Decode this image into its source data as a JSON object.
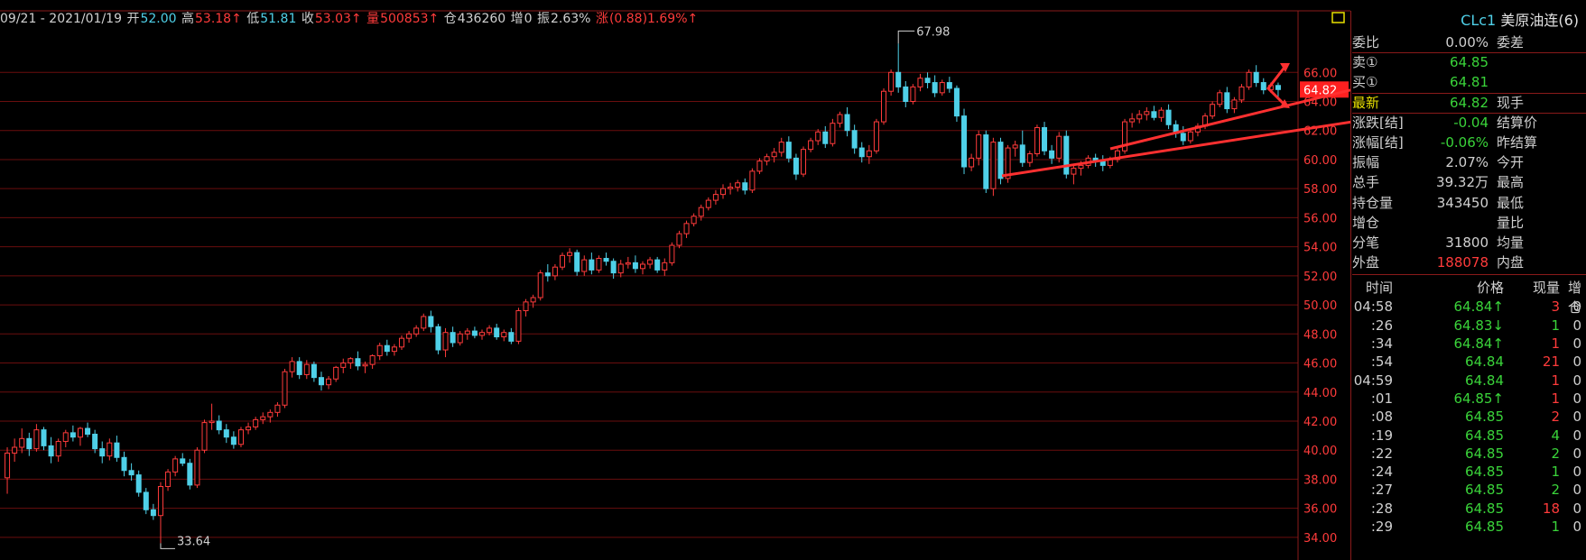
{
  "topbar": {
    "date_range": "09/21 - 2021/01/19",
    "open_label": "开",
    "open_val": "52.00",
    "high_label": "高",
    "high_val": "53.18↑",
    "low_label": "低",
    "low_val": "51.81",
    "close_label": "收",
    "close_val": "53.03↑",
    "vol_label": "量",
    "vol_val": "500853↑",
    "oi_label": "仓",
    "oi_val": "436260",
    "add_label": "增",
    "add_val": "0",
    "amp_label": "振",
    "amp_val": "2.63%",
    "chg_label": "涨",
    "chg_val": "(0.88)1.69%↑"
  },
  "chart_data": {
    "type": "candlestick",
    "y_ticks": [
      "66.00",
      "64.00",
      "62.00",
      "60.00",
      "58.00",
      "56.00",
      "54.00",
      "52.00",
      "50.00",
      "48.00",
      "46.00",
      "44.00",
      "42.00",
      "40.00",
      "38.00",
      "36.00",
      "34.00"
    ],
    "ylim": [
      33,
      68.5
    ],
    "current_price": "64.82",
    "high_annotation": "67.98",
    "low_annotation": "33.64",
    "candles": [
      [
        38.1,
        40.2,
        37.0,
        39.8
      ],
      [
        39.8,
        40.8,
        39.2,
        40.2
      ],
      [
        40.2,
        41.5,
        39.8,
        40.8
      ],
      [
        40.8,
        41.2,
        39.6,
        40.1
      ],
      [
        40.1,
        41.8,
        39.9,
        41.4
      ],
      [
        41.4,
        41.6,
        40.0,
        40.3
      ],
      [
        40.3,
        40.9,
        39.1,
        39.6
      ],
      [
        39.6,
        40.8,
        39.2,
        40.6
      ],
      [
        40.6,
        41.4,
        40.2,
        41.2
      ],
      [
        41.2,
        41.7,
        40.6,
        40.9
      ],
      [
        40.9,
        41.6,
        40.3,
        41.5
      ],
      [
        41.5,
        41.9,
        40.9,
        41.1
      ],
      [
        41.1,
        41.4,
        39.8,
        40.1
      ],
      [
        40.1,
        40.6,
        39.1,
        39.6
      ],
      [
        39.6,
        40.8,
        39.3,
        40.5
      ],
      [
        40.5,
        41.0,
        39.2,
        39.5
      ],
      [
        39.5,
        39.9,
        38.2,
        38.6
      ],
      [
        38.6,
        39.1,
        37.9,
        38.3
      ],
      [
        38.3,
        38.6,
        36.8,
        37.1
      ],
      [
        37.1,
        37.4,
        35.6,
        35.9
      ],
      [
        35.9,
        36.3,
        35.2,
        35.5
      ],
      [
        35.5,
        37.8,
        33.6,
        37.5
      ],
      [
        37.5,
        38.7,
        37.2,
        38.5
      ],
      [
        38.5,
        39.6,
        38.2,
        39.4
      ],
      [
        39.4,
        39.8,
        38.9,
        39.1
      ],
      [
        39.1,
        39.4,
        37.3,
        37.6
      ],
      [
        37.6,
        40.2,
        37.4,
        40.0
      ],
      [
        40.0,
        42.1,
        39.8,
        41.9
      ],
      [
        41.9,
        43.2,
        41.4,
        42.0
      ],
      [
        42.0,
        42.4,
        41.1,
        41.4
      ],
      [
        41.4,
        41.8,
        40.5,
        40.9
      ],
      [
        40.9,
        41.3,
        40.1,
        40.4
      ],
      [
        40.4,
        41.6,
        40.2,
        41.4
      ],
      [
        41.4,
        41.9,
        41.1,
        41.6
      ],
      [
        41.6,
        42.3,
        41.4,
        42.1
      ],
      [
        42.1,
        42.6,
        41.8,
        42.3
      ],
      [
        42.3,
        42.8,
        41.9,
        42.6
      ],
      [
        42.6,
        43.3,
        42.3,
        43.1
      ],
      [
        43.1,
        45.6,
        42.9,
        45.4
      ],
      [
        45.4,
        46.4,
        45.0,
        46.1
      ],
      [
        46.1,
        46.4,
        44.9,
        45.2
      ],
      [
        45.2,
        46.2,
        44.9,
        45.9
      ],
      [
        45.9,
        46.1,
        44.7,
        45.0
      ],
      [
        45.0,
        45.4,
        44.1,
        44.5
      ],
      [
        44.5,
        45.1,
        44.2,
        44.9
      ],
      [
        44.9,
        45.8,
        44.7,
        45.7
      ],
      [
        45.7,
        46.3,
        45.3,
        46.0
      ],
      [
        46.0,
        46.4,
        45.6,
        46.3
      ],
      [
        46.3,
        46.8,
        45.5,
        45.8
      ],
      [
        45.8,
        46.1,
        45.3,
        45.9
      ],
      [
        45.9,
        46.6,
        45.6,
        46.5
      ],
      [
        46.5,
        47.4,
        46.2,
        47.2
      ],
      [
        47.2,
        47.6,
        46.5,
        46.8
      ],
      [
        46.8,
        47.3,
        46.5,
        47.1
      ],
      [
        47.1,
        47.9,
        46.9,
        47.7
      ],
      [
        47.7,
        48.2,
        47.4,
        48.0
      ],
      [
        48.0,
        48.6,
        47.8,
        48.4
      ],
      [
        48.4,
        49.4,
        48.2,
        49.2
      ],
      [
        49.2,
        49.6,
        48.1,
        48.5
      ],
      [
        48.5,
        48.7,
        46.6,
        46.9
      ],
      [
        46.9,
        48.4,
        46.4,
        48.1
      ],
      [
        48.1,
        48.5,
        47.1,
        47.4
      ],
      [
        47.4,
        48.2,
        47.2,
        48.0
      ],
      [
        48.0,
        48.4,
        47.6,
        48.2
      ],
      [
        48.2,
        48.5,
        47.7,
        47.9
      ],
      [
        47.9,
        48.3,
        47.6,
        48.1
      ],
      [
        48.1,
        48.6,
        47.9,
        48.4
      ],
      [
        48.4,
        48.7,
        47.6,
        47.8
      ],
      [
        47.8,
        48.3,
        47.5,
        48.1
      ],
      [
        48.1,
        48.4,
        47.3,
        47.5
      ],
      [
        47.5,
        49.8,
        47.3,
        49.6
      ],
      [
        49.6,
        50.4,
        49.2,
        50.2
      ],
      [
        50.2,
        50.7,
        49.8,
        50.5
      ],
      [
        50.5,
        52.4,
        50.3,
        52.2
      ],
      [
        52.2,
        52.8,
        51.6,
        52.0
      ],
      [
        52.0,
        52.8,
        51.7,
        52.6
      ],
      [
        52.6,
        53.6,
        52.4,
        53.4
      ],
      [
        53.4,
        53.9,
        52.9,
        53.6
      ],
      [
        53.6,
        53.8,
        52.0,
        52.3
      ],
      [
        52.3,
        53.4,
        52.0,
        53.1
      ],
      [
        53.1,
        53.6,
        52.1,
        52.4
      ],
      [
        52.4,
        53.4,
        52.2,
        53.2
      ],
      [
        53.2,
        53.6,
        52.7,
        53.0
      ],
      [
        53.0,
        53.2,
        51.8,
        52.2
      ],
      [
        52.2,
        53.1,
        51.9,
        52.8
      ],
      [
        52.8,
        53.3,
        52.5,
        52.9
      ],
      [
        52.9,
        53.4,
        52.2,
        52.5
      ],
      [
        52.5,
        53.0,
        52.1,
        52.8
      ],
      [
        52.8,
        53.3,
        52.5,
        53.1
      ],
      [
        53.1,
        53.3,
        52.2,
        52.4
      ],
      [
        52.4,
        53.2,
        52.0,
        52.9
      ],
      [
        52.9,
        54.3,
        52.7,
        54.1
      ],
      [
        54.1,
        55.1,
        53.9,
        54.9
      ],
      [
        54.9,
        55.8,
        54.6,
        55.6
      ],
      [
        55.6,
        56.3,
        55.4,
        56.1
      ],
      [
        56.1,
        56.9,
        55.8,
        56.7
      ],
      [
        56.7,
        57.4,
        56.5,
        57.2
      ],
      [
        57.2,
        57.9,
        56.9,
        57.6
      ],
      [
        57.6,
        58.3,
        57.3,
        58.0
      ],
      [
        58.0,
        58.4,
        57.6,
        58.1
      ],
      [
        58.1,
        58.6,
        57.8,
        58.4
      ],
      [
        58.4,
        58.7,
        57.6,
        57.9
      ],
      [
        57.9,
        59.4,
        57.7,
        59.2
      ],
      [
        59.2,
        60.1,
        59.0,
        59.9
      ],
      [
        59.9,
        60.4,
        59.6,
        60.2
      ],
      [
        60.2,
        60.8,
        59.8,
        60.5
      ],
      [
        60.5,
        61.5,
        60.2,
        61.2
      ],
      [
        61.2,
        61.6,
        59.8,
        60.1
      ],
      [
        60.1,
        60.4,
        58.6,
        59.0
      ],
      [
        59.0,
        60.9,
        58.8,
        60.7
      ],
      [
        60.7,
        61.5,
        60.5,
        61.3
      ],
      [
        61.3,
        62.1,
        61.0,
        61.9
      ],
      [
        61.9,
        62.3,
        60.8,
        61.1
      ],
      [
        61.1,
        62.8,
        60.9,
        62.5
      ],
      [
        62.5,
        63.3,
        62.2,
        63.1
      ],
      [
        63.1,
        63.6,
        61.6,
        62.0
      ],
      [
        62.0,
        62.4,
        60.4,
        60.8
      ],
      [
        60.8,
        61.2,
        59.8,
        60.2
      ],
      [
        60.2,
        61.0,
        59.7,
        60.6
      ],
      [
        60.6,
        62.8,
        60.4,
        62.6
      ],
      [
        62.6,
        64.9,
        62.4,
        64.7
      ],
      [
        64.7,
        66.2,
        64.4,
        66.0
      ],
      [
        66.0,
        67.98,
        64.6,
        65.0
      ],
      [
        65.0,
        65.4,
        63.6,
        64.0
      ],
      [
        64.0,
        65.2,
        63.8,
        65.0
      ],
      [
        65.0,
        65.9,
        64.7,
        65.6
      ],
      [
        65.6,
        66.0,
        64.9,
        65.3
      ],
      [
        65.3,
        65.8,
        64.3,
        64.6
      ],
      [
        64.6,
        65.5,
        64.4,
        65.3
      ],
      [
        65.3,
        65.7,
        64.6,
        64.9
      ],
      [
        64.9,
        65.1,
        62.6,
        63.0
      ],
      [
        63.0,
        63.5,
        59.0,
        59.5
      ],
      [
        59.5,
        60.4,
        59.2,
        60.1
      ],
      [
        60.1,
        62.0,
        59.6,
        61.7
      ],
      [
        61.7,
        62.0,
        57.7,
        58.0
      ],
      [
        58.0,
        61.5,
        57.5,
        61.2
      ],
      [
        61.2,
        61.5,
        58.3,
        58.7
      ],
      [
        58.7,
        61.0,
        58.4,
        60.8
      ],
      [
        60.8,
        61.3,
        60.2,
        61.0
      ],
      [
        61.0,
        62.0,
        59.5,
        59.8
      ],
      [
        59.8,
        60.6,
        59.5,
        60.4
      ],
      [
        60.4,
        62.4,
        60.2,
        62.2
      ],
      [
        62.2,
        62.6,
        60.3,
        60.6
      ],
      [
        60.6,
        61.0,
        59.7,
        60.1
      ],
      [
        60.1,
        61.9,
        59.8,
        61.6
      ],
      [
        61.6,
        62.0,
        58.7,
        59.0
      ],
      [
        59.0,
        59.7,
        58.3,
        59.4
      ],
      [
        59.4,
        59.9,
        58.9,
        59.6
      ],
      [
        59.6,
        60.3,
        59.4,
        60.1
      ],
      [
        60.1,
        60.4,
        59.5,
        59.9
      ],
      [
        59.9,
        60.3,
        59.2,
        59.6
      ],
      [
        59.6,
        60.2,
        59.4,
        60.0
      ],
      [
        60.0,
        60.8,
        59.8,
        60.6
      ],
      [
        60.6,
        62.8,
        60.4,
        62.6
      ],
      [
        62.6,
        63.2,
        62.2,
        62.8
      ],
      [
        62.8,
        63.4,
        62.5,
        63.1
      ],
      [
        63.1,
        63.6,
        62.7,
        63.3
      ],
      [
        63.3,
        63.7,
        62.7,
        62.9
      ],
      [
        62.9,
        63.6,
        62.6,
        63.4
      ],
      [
        63.4,
        63.8,
        62.1,
        62.4
      ],
      [
        62.4,
        62.7,
        61.5,
        61.8
      ],
      [
        61.8,
        62.3,
        61.0,
        61.3
      ],
      [
        61.3,
        62.1,
        61.1,
        61.9
      ],
      [
        61.9,
        62.5,
        61.6,
        62.3
      ],
      [
        62.3,
        63.2,
        62.1,
        63.0
      ],
      [
        63.0,
        64.0,
        62.8,
        63.8
      ],
      [
        63.8,
        64.8,
        63.6,
        64.6
      ],
      [
        64.6,
        65.0,
        63.2,
        63.5
      ],
      [
        63.5,
        64.3,
        63.2,
        64.1
      ],
      [
        64.1,
        65.2,
        63.9,
        65.0
      ],
      [
        65.0,
        66.2,
        64.8,
        66.0
      ],
      [
        66.0,
        66.5,
        65.0,
        65.3
      ],
      [
        65.3,
        65.6,
        64.5,
        64.8
      ],
      [
        64.8,
        65.3,
        64.6,
        65.1
      ],
      [
        65.1,
        65.3,
        64.3,
        64.82
      ]
    ]
  },
  "right_panel": {
    "title_symbol": "CLc1",
    "title_name": "美原油连",
    "title_suffix": "(6)",
    "rows": [
      {
        "k": "委比",
        "v": "0.00%",
        "k2": "委差",
        "vc": "#d0d0d0"
      },
      {
        "k": "卖①",
        "v": "64.85",
        "k2": "",
        "vc": "#3ad43a"
      },
      {
        "k": "买①",
        "v": "64.81",
        "k2": "",
        "vc": "#3ad43a"
      },
      {
        "k": "最新",
        "v": "64.82",
        "k2": "现手",
        "vc": "#3ad43a",
        "kc": "#e8e000"
      },
      {
        "k": "涨跌[结]",
        "v": "-0.04",
        "k2": "结算价",
        "vc": "#3ad43a"
      },
      {
        "k": "涨幅[结]",
        "v": "-0.06%",
        "k2": "昨结算",
        "vc": "#3ad43a"
      },
      {
        "k": "振幅",
        "v": "2.07%",
        "k2": "今开",
        "vc": "#d0d0d0"
      },
      {
        "k": "总手",
        "v": "39.32万",
        "k2": "最高",
        "vc": "#d0d0d0"
      },
      {
        "k": "持仓量",
        "v": "343450",
        "k2": "最低",
        "vc": "#d0d0d0"
      },
      {
        "k": "增仓",
        "v": "",
        "k2": "量比",
        "vc": "#d0d0d0"
      },
      {
        "k": "分笔",
        "v": "31800",
        "k2": "均量",
        "vc": "#d0d0d0"
      },
      {
        "k": "外盘",
        "v": "188078",
        "k2": "内盘",
        "vc": "#ff3b3b"
      }
    ],
    "tick_headers": {
      "time": "时间",
      "price": "价格",
      "qty": "现量",
      "oi": "增仓"
    },
    "ticks": [
      {
        "t": "04:58",
        "p": "64.84↑",
        "q": "3",
        "z": "0",
        "pc": "#3ad43a",
        "qc": "#ff3b3b",
        "tc": "#d0d0d0"
      },
      {
        "t": ":26",
        "p": "64.83↓",
        "q": "1",
        "z": "0",
        "pc": "#3ad43a",
        "qc": "#3ad43a",
        "tc": "#d0d0d0"
      },
      {
        "t": ":34",
        "p": "64.84↑",
        "q": "1",
        "z": "0",
        "pc": "#3ad43a",
        "qc": "#ff3b3b",
        "tc": "#d0d0d0"
      },
      {
        "t": ":54",
        "p": "64.84",
        "q": "21",
        "z": "0",
        "pc": "#3ad43a",
        "qc": "#ff3b3b",
        "tc": "#d0d0d0"
      },
      {
        "t": "04:59",
        "p": "64.84",
        "q": "1",
        "z": "0",
        "pc": "#3ad43a",
        "qc": "#ff3b3b",
        "tc": "#d0d0d0"
      },
      {
        "t": ":01",
        "p": "64.85↑",
        "q": "1",
        "z": "0",
        "pc": "#3ad43a",
        "qc": "#ff3b3b",
        "tc": "#d0d0d0"
      },
      {
        "t": ":08",
        "p": "64.85",
        "q": "2",
        "z": "0",
        "pc": "#3ad43a",
        "qc": "#ff3b3b",
        "tc": "#d0d0d0"
      },
      {
        "t": ":19",
        "p": "64.85",
        "q": "4",
        "z": "0",
        "pc": "#3ad43a",
        "qc": "#3ad43a",
        "tc": "#d0d0d0"
      },
      {
        "t": ":22",
        "p": "64.85",
        "q": "2",
        "z": "0",
        "pc": "#3ad43a",
        "qc": "#3ad43a",
        "tc": "#d0d0d0"
      },
      {
        "t": ":24",
        "p": "64.85",
        "q": "1",
        "z": "0",
        "pc": "#3ad43a",
        "qc": "#3ad43a",
        "tc": "#d0d0d0"
      },
      {
        "t": ":27",
        "p": "64.85",
        "q": "2",
        "z": "0",
        "pc": "#3ad43a",
        "qc": "#3ad43a",
        "tc": "#d0d0d0"
      },
      {
        "t": ":28",
        "p": "64.85",
        "q": "18",
        "z": "0",
        "pc": "#3ad43a",
        "qc": "#ff3b3b",
        "tc": "#d0d0d0"
      },
      {
        "t": ":29",
        "p": "64.85",
        "q": "1",
        "z": "0",
        "pc": "#3ad43a",
        "qc": "#3ad43a",
        "tc": "#d0d0d0"
      }
    ]
  },
  "colors": {
    "up": "#ff3b3b",
    "down": "#4fd0e8",
    "grid": "#6a0e0e",
    "axis_text": "#ff3b3b",
    "annotation_arrows": "#ff3030"
  }
}
